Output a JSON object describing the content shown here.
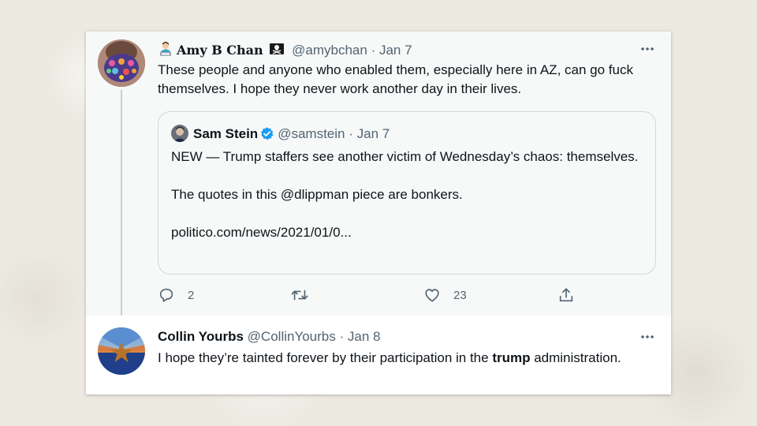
{
  "tweet1": {
    "author_emoji": "woman-technologist-emoji",
    "author_name": "Amy B Chan",
    "author_flag": "pirate-flag-emoji",
    "author_handle": "@amybchan",
    "date": "Jan 7",
    "text": "These people and anyone who enabled them, especially here in AZ, can go fuck themselves. I hope they never work another day in their lives.",
    "quote": {
      "author_name": "Sam Stein",
      "verified": true,
      "author_handle": "@samstein",
      "date": "Jan 7",
      "line1": "NEW — Trump staffers see another victim of Wednesday’s chaos: themselves.",
      "line2": "The quotes in this @dlippman piece are bonkers.",
      "link": "politico.com/news/2021/01/0..."
    },
    "actions": {
      "reply_count": "2",
      "retweet_count": "",
      "like_count": "23"
    }
  },
  "tweet2": {
    "author_name": "Collin Yourbs",
    "author_handle": "@CollinYourbs",
    "date": "Jan 8",
    "text_before": "I hope they’re tainted forever by their participation in the ",
    "text_bold": "trump",
    "text_after": " administration."
  },
  "separator": " · ",
  "colors": {
    "text_primary": "#0f1419",
    "text_secondary": "#536471",
    "verified_blue": "#1d9bf0",
    "thread_line": "#c4cfd6",
    "border": "#cfd9de"
  }
}
